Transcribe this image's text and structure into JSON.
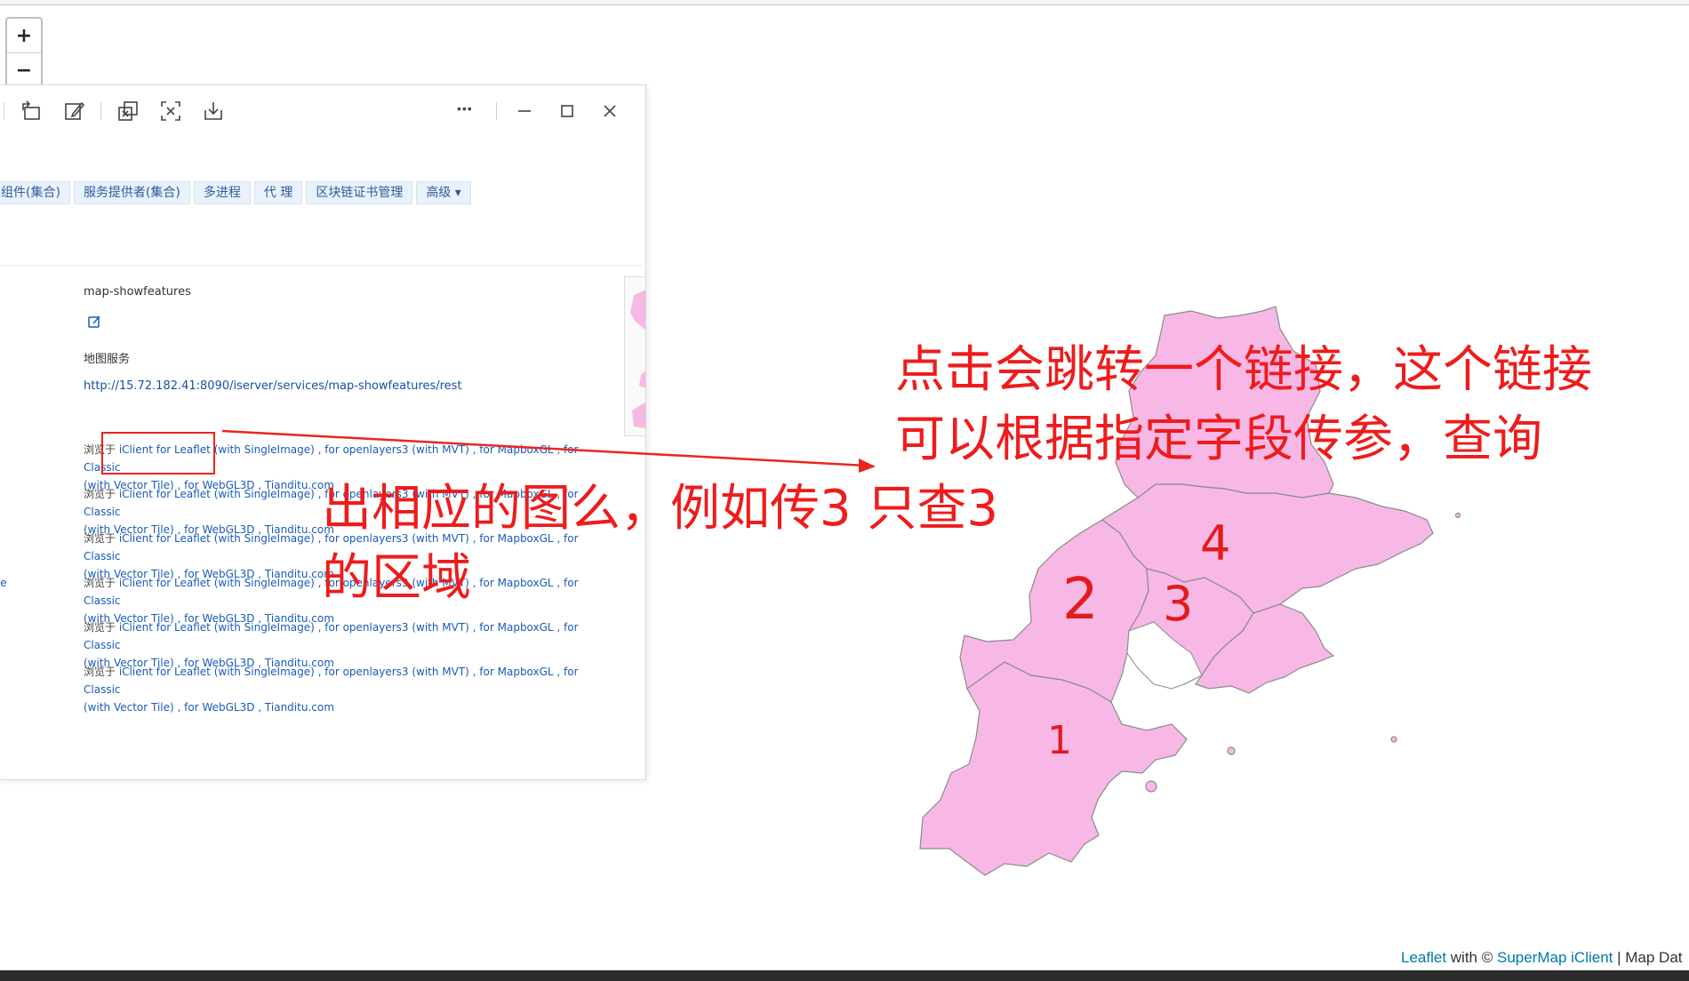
{
  "zoom": {
    "in_label": "+",
    "out_label": "−"
  },
  "toolbar": {
    "icons": [
      "rotate-icon",
      "edit-icon",
      "copy-icon",
      "capture-icon",
      "download-icon",
      "more-icon",
      "minimize-icon",
      "maximize-icon",
      "close-icon"
    ],
    "more_label": "•••"
  },
  "tabs": [
    "组件(集合)",
    "服务提供者(集合)",
    "多进程",
    "代 理",
    "区块链证书管理",
    "高级 ▾"
  ],
  "service": {
    "name": "map-showfeatures",
    "type": "地图服务",
    "url": "http://15.72.182.41:8090/iserver/services/map-showfeatures/rest"
  },
  "rows": [
    {
      "prefix": "浏览于 ",
      "leaflet": "iClient for Leaflet",
      "rest1": " (with SingleImage) , for openlayers3 (with MVT) , for MapboxGL , for Classic",
      "line2": "(with Vector Tile) , for WebGL3D , Tianditu.com"
    },
    {
      "prefix": "浏览于 ",
      "leaflet": "iClient for Leaflet",
      "rest1": " (with SingleImage) , for openlayers3 (with MVT) , for MapboxGL , for Classic",
      "line2": "(with Vector Tile) , for WebGL3D , Tianditu.com"
    },
    {
      "prefix": "浏览于 ",
      "leaflet": "iClient for Leaflet",
      "rest1": " (with SingleImage) , for openlayers3 (with MVT) , for MapboxGL , for Classic",
      "line2": "(with Vector Tile) , for WebGL3D , Tianditu.com"
    },
    {
      "prefix": "浏览于 ",
      "leaflet": "iClient for Leaflet",
      "rest1": " (with SingleImage) , for openlayers3 (with MVT) , for MapboxGL , for Classic",
      "line2": "(with Vector Tile) , for WebGL3D , Tianditu.com"
    },
    {
      "prefix": "浏览于 ",
      "leaflet": "iClient for Leaflet",
      "rest1": " (with SingleImage) , for openlayers3 (with MVT) , for MapboxGL , for Classic",
      "line2": "(with Vector Tile) , for WebGL3D , Tianditu.com"
    },
    {
      "prefix": "浏览于 ",
      "leaflet": "iClient for Leaflet",
      "rest1": " (with SingleImage) , for openlayers3 (with MVT) , for MapboxGL , for Classic",
      "line2": "(with Vector Tile) , for WebGL3D , Tianditu.com"
    }
  ],
  "cut_text": "re",
  "annotation": {
    "line1": "点击会跳转一个链接，这个链接",
    "line2": "可以根据指定字段传参，查询",
    "line3": "出相应的图么，例如传3 只查3",
    "line4": "的区域"
  },
  "regions": [
    "1",
    "2",
    "3",
    "4"
  ],
  "attribution": {
    "leaflet": "Leaflet",
    "with": " with © ",
    "supermap": "SuperMap iClient",
    "rest": " | Map Dat"
  },
  "colors": {
    "region_fill": "#f7b8e6",
    "annotation": "#ee1c1c",
    "link": "#1a5bb5"
  }
}
